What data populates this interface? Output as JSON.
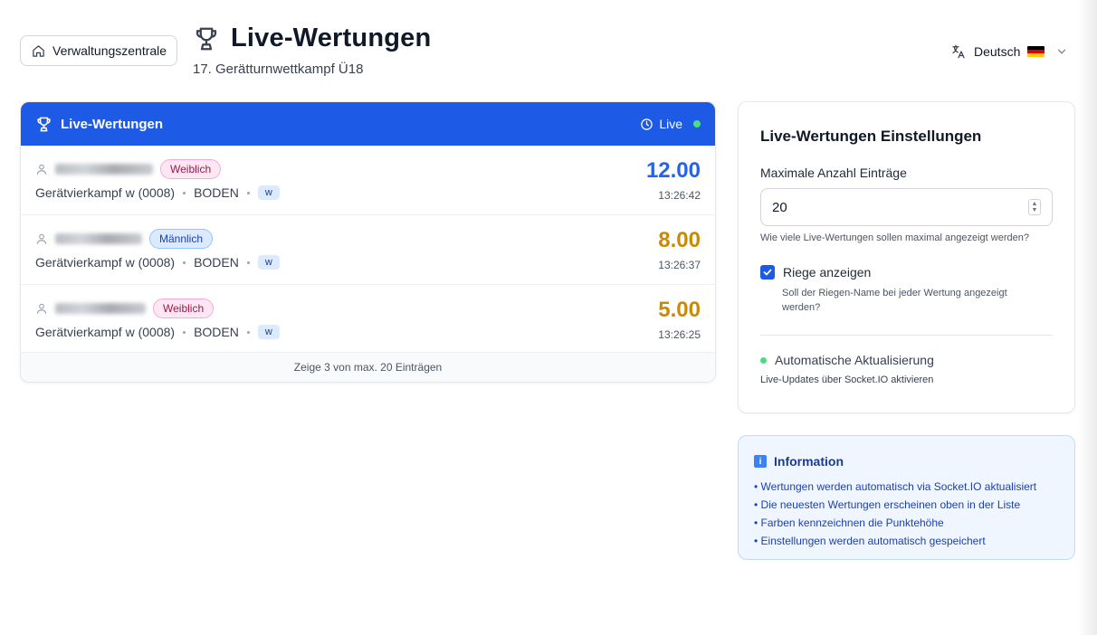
{
  "header": {
    "home_button": "Verwaltungszentrale",
    "title": "Live-Wertungen",
    "subtitle": "17. Gerätturnwettkampf Ü18",
    "language": "Deutsch"
  },
  "live_card": {
    "title": "Live-Wertungen",
    "status": "Live",
    "entries": [
      {
        "gender": "Weiblich",
        "competition": "Gerätvierkampf w (0008)",
        "apparatus": "BODEN",
        "riege": "w",
        "score": "12.00",
        "time": "13:26:42",
        "score_color": "#2563eb"
      },
      {
        "gender": "Männlich",
        "competition": "Gerätvierkampf w (0008)",
        "apparatus": "BODEN",
        "riege": "w",
        "score": "8.00",
        "time": "13:26:37",
        "score_color": "#ca8a04"
      },
      {
        "gender": "Weiblich",
        "competition": "Gerätvierkampf w (0008)",
        "apparatus": "BODEN",
        "riege": "w",
        "score": "5.00",
        "time": "13:26:25",
        "score_color": "#ca8a04"
      }
    ],
    "footer": "Zeige 3 von max. 20 Einträgen"
  },
  "settings": {
    "title": "Live-Wertungen Einstellungen",
    "max_label": "Maximale Anzahl Einträge",
    "max_value": "20",
    "max_hint": "Wie viele Live-Wertungen sollen maximal angezeigt werden?",
    "riege_label": "Riege anzeigen",
    "riege_hint": "Soll der Riegen-Name bei jeder Wertung angezeigt werden?",
    "auto_label": "Automatische Aktualisierung",
    "auto_hint": "Live-Updates über Socket.IO aktivieren"
  },
  "info": {
    "title": "Information",
    "items": [
      "• Wertungen werden automatisch via Socket.IO aktualisiert",
      "• Die neuesten Wertungen erscheinen oben in der Liste",
      "• Farben kennzeichnen die Punktehöhe",
      "• Einstellungen werden automatisch gespeichert"
    ]
  },
  "colors": {
    "primary": "#1d5ae6",
    "live_dot": "#4ade80",
    "score_high": "#2563eb",
    "score_mid": "#ca8a04"
  }
}
